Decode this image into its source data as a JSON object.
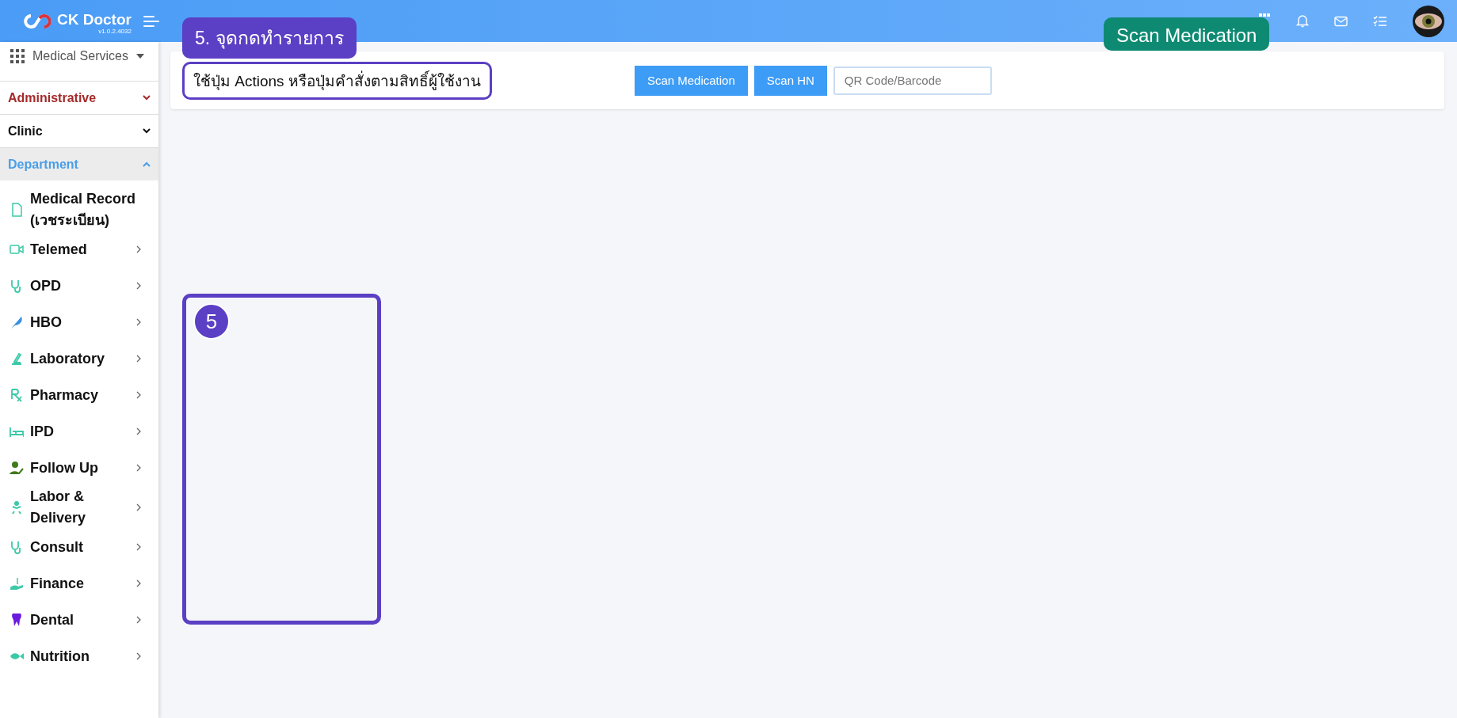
{
  "header": {
    "brand": "CK Doctor",
    "version": "v1.0.2.4032"
  },
  "callouts": [
    {
      "kind": "title",
      "text": "5. จุดกดทำรายการ"
    },
    {
      "kind": "tag",
      "text": "Scan Medication"
    },
    {
      "kind": "number",
      "text": "5"
    }
  ],
  "sidebar": {
    "menu": "Medical Services",
    "sections": [
      {
        "label": "Administrative",
        "color": "#a52a2a",
        "expanded": false
      },
      {
        "label": "Clinic",
        "color": "#111111",
        "expanded": false
      },
      {
        "label": "Department",
        "color": "#4a9ee8",
        "expanded": true
      }
    ],
    "items": [
      {
        "label": "Medical Record (เวชระเบียน)",
        "has_submenu": false
      },
      {
        "label": "Telemed",
        "has_submenu": true
      },
      {
        "label": "OPD",
        "has_submenu": true
      },
      {
        "label": "HBO",
        "has_submenu": true
      },
      {
        "label": "Laboratory",
        "has_submenu": true
      },
      {
        "label": "Pharmacy",
        "has_submenu": true
      },
      {
        "label": "IPD",
        "has_submenu": true
      },
      {
        "label": "Follow Up",
        "has_submenu": true
      },
      {
        "label": "Labor & Delivery",
        "has_submenu": true
      },
      {
        "label": "Consult",
        "has_submenu": true
      },
      {
        "label": "Finance",
        "has_submenu": true
      },
      {
        "label": "Dental",
        "has_submenu": true
      },
      {
        "label": "Nutrition",
        "has_submenu": true
      }
    ]
  },
  "toolbar": {
    "hint": "ใช้ปุ่ม Actions หรือปุ่มคำสั่งตามสิทธิ์ผู้ใช้งาน",
    "buttons": [
      "Scan Medication",
      "Scan HN"
    ],
    "search": {
      "placeholder": "QR Code/Barcode"
    }
  }
}
